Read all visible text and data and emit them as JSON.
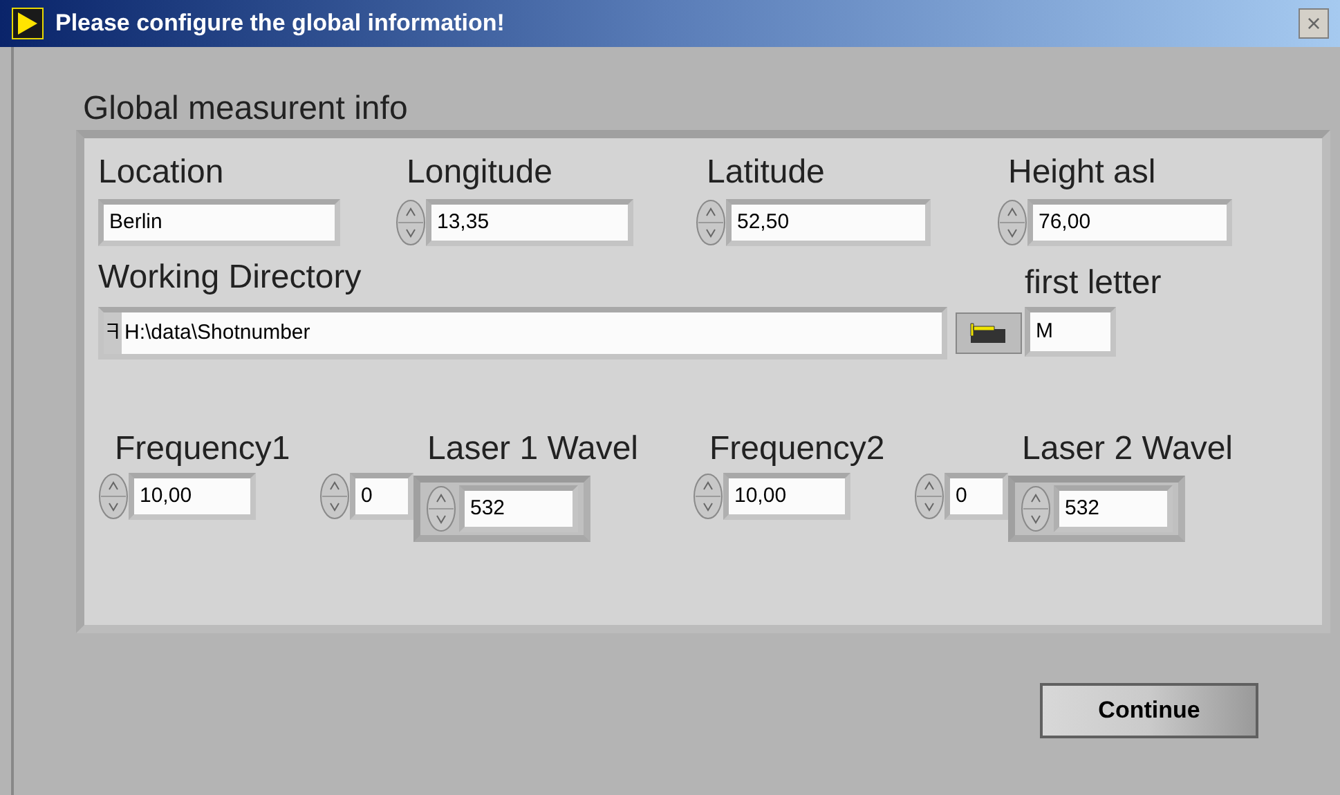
{
  "window": {
    "title": "Please configure the global information!",
    "close": "×"
  },
  "group": {
    "label": "Global measurent info"
  },
  "row1": [
    {
      "kind": "text",
      "label": "Location",
      "value": "Berlin"
    },
    {
      "kind": "numeric",
      "label": "Longitude",
      "value": "13,35"
    },
    {
      "kind": "numeric",
      "label": "Latitude",
      "value": "52,50"
    },
    {
      "kind": "numeric",
      "label": "Height asl",
      "value": "76,00"
    }
  ],
  "working_directory": {
    "label": "Working Directory",
    "path_symbol": "ᖷ",
    "value": "H:\\data\\Shotnumber"
  },
  "first_letter": {
    "label": "first letter",
    "value": "M"
  },
  "row3": [
    {
      "label": "Frequency1",
      "value": "10,00",
      "index": "0",
      "laser_label": "Laser 1 Wavel",
      "laser_value": "532"
    },
    {
      "label": "Frequency2",
      "value": "10,00",
      "index": "0",
      "laser_label": "Laser 2 Wavel",
      "laser_value": "532"
    }
  ],
  "continue_button": "Continue"
}
